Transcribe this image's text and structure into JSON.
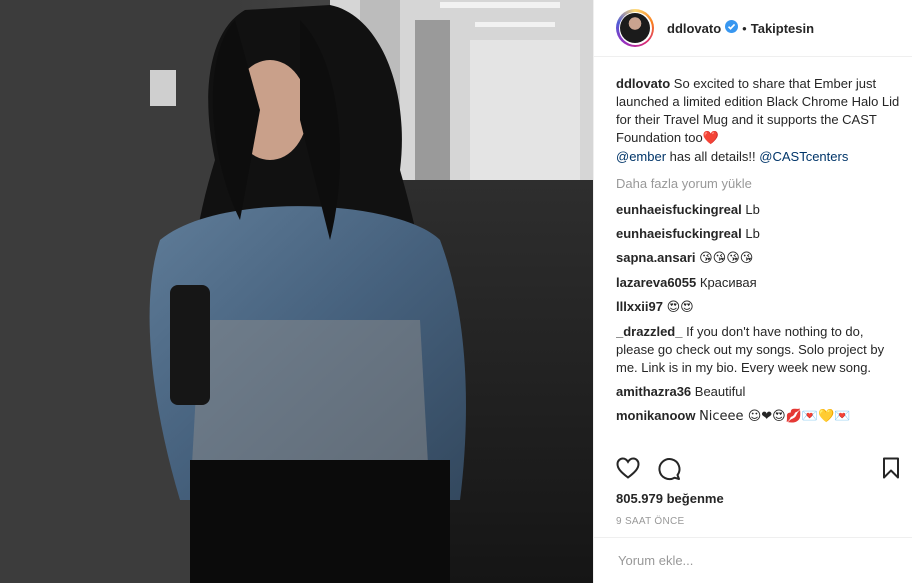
{
  "header": {
    "username": "ddlovato",
    "separator": "•",
    "follow_status": "Takiptesin"
  },
  "caption": {
    "username": "ddlovato",
    "text": "So excited to share that Ember just launched a limited edition Black Chrome Halo Lid for their Travel Mug and it supports the CAST Foundation too",
    "emoji": "❤️",
    "mention1": "@ember",
    "mid": " has all details!! ",
    "mention2": "@CASTcenters"
  },
  "load_more": "Daha fazla yorum yükle",
  "comments": [
    {
      "username": "eunhaeisfuckingreal",
      "text": "Lb"
    },
    {
      "username": "eunhaeisfuckingreal",
      "text": "Lb"
    },
    {
      "username": "sapna.ansari",
      "text": "😘😘😘😘"
    },
    {
      "username": "lazareva6055",
      "text": "Красивая"
    },
    {
      "username": "lllxxii97",
      "text": "😍😍"
    },
    {
      "username": "_drazzled_",
      "text": "If you don't have nothing to do, please go check out my songs. Solo project by me. Link is in my bio. Every week new song."
    },
    {
      "username": "amithazra36",
      "text": "Beautiful"
    },
    {
      "username": "monikanoow",
      "text": "Niceee ☺❤😍💋💌💛💌"
    }
  ],
  "likes": "805.979 beğenme",
  "timestamp": "9 SAAT ÖNCE",
  "add_comment_placeholder": "Yorum ekle...",
  "icons": {
    "like": "heart-icon",
    "comment": "comment-icon",
    "save": "bookmark-icon",
    "verified": "verified-badge-icon"
  },
  "colors": {
    "verified": "#3897f0",
    "mention": "#003569",
    "muted": "#999999"
  }
}
